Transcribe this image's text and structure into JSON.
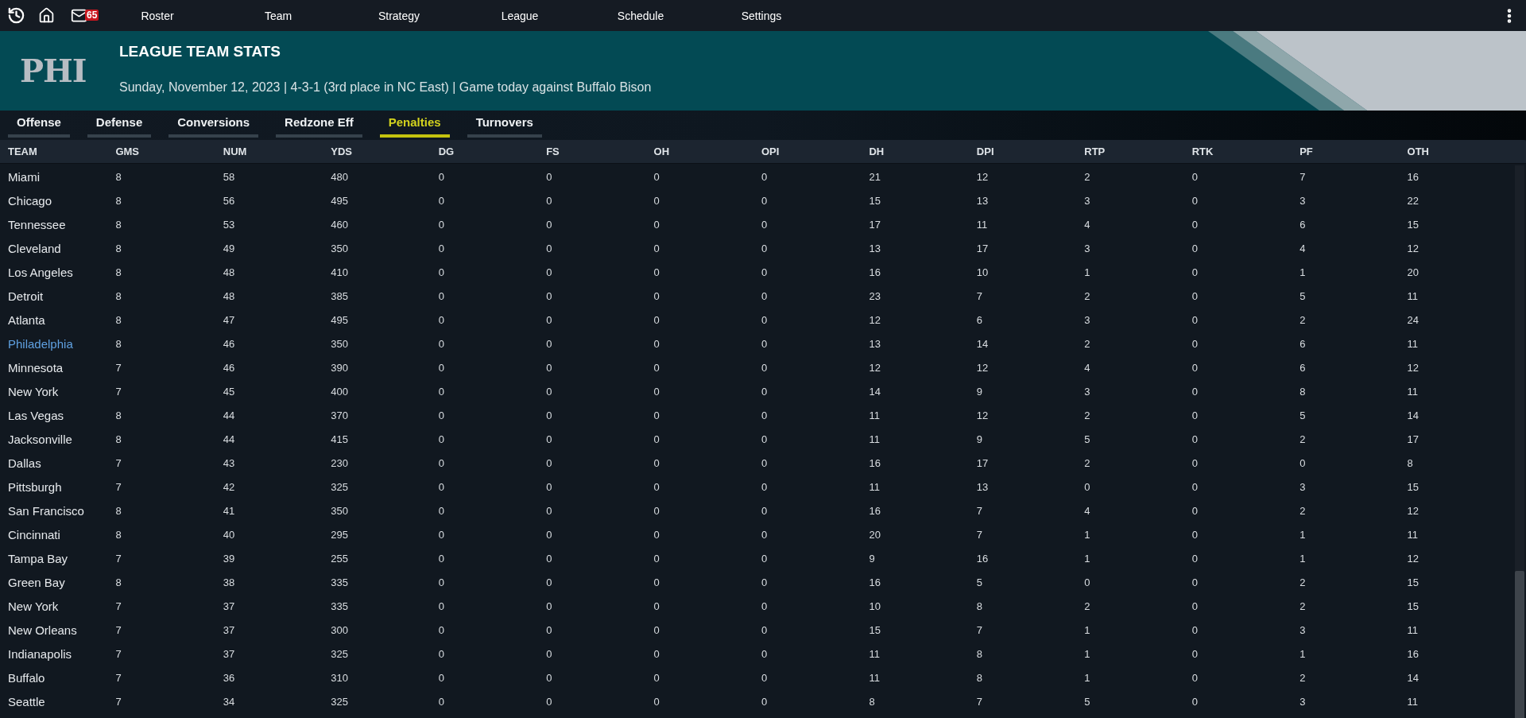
{
  "top_bar": {
    "mail_badge": "65",
    "nav": [
      {
        "label": "Roster"
      },
      {
        "label": "Team"
      },
      {
        "label": "Strategy"
      },
      {
        "label": "League"
      },
      {
        "label": "Schedule"
      },
      {
        "label": "Settings"
      }
    ]
  },
  "header": {
    "logo_text": "PHI",
    "title": "LEAGUE TEAM STATS",
    "subtitle": "Sunday, November 12, 2023 | 4-3-1 (3rd place in NC East) | Game today against Buffalo Bison"
  },
  "tabs": [
    {
      "label": "Offense",
      "selected": false
    },
    {
      "label": "Defense",
      "selected": false
    },
    {
      "label": "Conversions",
      "selected": false
    },
    {
      "label": "Redzone Eff",
      "selected": false
    },
    {
      "label": "Penalties",
      "selected": true
    },
    {
      "label": "Turnovers",
      "selected": false
    }
  ],
  "table": {
    "columns": [
      "TEAM",
      "GMS",
      "NUM",
      "YDS",
      "DG",
      "FS",
      "OH",
      "OPI",
      "DH",
      "DPI",
      "RTP",
      "RTK",
      "PF",
      "OTH"
    ],
    "rows": [
      {
        "team": "Miami",
        "values": [
          "8",
          "58",
          "480",
          "0",
          "0",
          "0",
          "0",
          "21",
          "12",
          "2",
          "0",
          "7",
          "16"
        ],
        "highlighted": false
      },
      {
        "team": "Chicago",
        "values": [
          "8",
          "56",
          "495",
          "0",
          "0",
          "0",
          "0",
          "15",
          "13",
          "3",
          "0",
          "3",
          "22"
        ],
        "highlighted": false
      },
      {
        "team": "Tennessee",
        "values": [
          "8",
          "53",
          "460",
          "0",
          "0",
          "0",
          "0",
          "17",
          "11",
          "4",
          "0",
          "6",
          "15"
        ],
        "highlighted": false
      },
      {
        "team": "Cleveland",
        "values": [
          "8",
          "49",
          "350",
          "0",
          "0",
          "0",
          "0",
          "13",
          "17",
          "3",
          "0",
          "4",
          "12"
        ],
        "highlighted": false
      },
      {
        "team": "Los Angeles",
        "values": [
          "8",
          "48",
          "410",
          "0",
          "0",
          "0",
          "0",
          "16",
          "10",
          "1",
          "0",
          "1",
          "20"
        ],
        "highlighted": false
      },
      {
        "team": "Detroit",
        "values": [
          "8",
          "48",
          "385",
          "0",
          "0",
          "0",
          "0",
          "23",
          "7",
          "2",
          "0",
          "5",
          "11"
        ],
        "highlighted": false
      },
      {
        "team": "Atlanta",
        "values": [
          "8",
          "47",
          "495",
          "0",
          "0",
          "0",
          "0",
          "12",
          "6",
          "3",
          "0",
          "2",
          "24"
        ],
        "highlighted": false
      },
      {
        "team": "Philadelphia",
        "values": [
          "8",
          "46",
          "350",
          "0",
          "0",
          "0",
          "0",
          "13",
          "14",
          "2",
          "0",
          "6",
          "11"
        ],
        "highlighted": true
      },
      {
        "team": "Minnesota",
        "values": [
          "7",
          "46",
          "390",
          "0",
          "0",
          "0",
          "0",
          "12",
          "12",
          "4",
          "0",
          "6",
          "12"
        ],
        "highlighted": false
      },
      {
        "team": "New York",
        "values": [
          "7",
          "45",
          "400",
          "0",
          "0",
          "0",
          "0",
          "14",
          "9",
          "3",
          "0",
          "8",
          "11"
        ],
        "highlighted": false
      },
      {
        "team": "Las Vegas",
        "values": [
          "8",
          "44",
          "370",
          "0",
          "0",
          "0",
          "0",
          "11",
          "12",
          "2",
          "0",
          "5",
          "14"
        ],
        "highlighted": false
      },
      {
        "team": "Jacksonville",
        "values": [
          "8",
          "44",
          "415",
          "0",
          "0",
          "0",
          "0",
          "11",
          "9",
          "5",
          "0",
          "2",
          "17"
        ],
        "highlighted": false
      },
      {
        "team": "Dallas",
        "values": [
          "7",
          "43",
          "230",
          "0",
          "0",
          "0",
          "0",
          "16",
          "17",
          "2",
          "0",
          "0",
          "8"
        ],
        "highlighted": false
      },
      {
        "team": "Pittsburgh",
        "values": [
          "7",
          "42",
          "325",
          "0",
          "0",
          "0",
          "0",
          "11",
          "13",
          "0",
          "0",
          "3",
          "15"
        ],
        "highlighted": false
      },
      {
        "team": "San Francisco",
        "values": [
          "8",
          "41",
          "350",
          "0",
          "0",
          "0",
          "0",
          "16",
          "7",
          "4",
          "0",
          "2",
          "12"
        ],
        "highlighted": false
      },
      {
        "team": "Cincinnati",
        "values": [
          "8",
          "40",
          "295",
          "0",
          "0",
          "0",
          "0",
          "20",
          "7",
          "1",
          "0",
          "1",
          "11"
        ],
        "highlighted": false
      },
      {
        "team": "Tampa Bay",
        "values": [
          "7",
          "39",
          "255",
          "0",
          "0",
          "0",
          "0",
          "9",
          "16",
          "1",
          "0",
          "1",
          "12"
        ],
        "highlighted": false
      },
      {
        "team": "Green Bay",
        "values": [
          "8",
          "38",
          "335",
          "0",
          "0",
          "0",
          "0",
          "16",
          "5",
          "0",
          "0",
          "2",
          "15"
        ],
        "highlighted": false
      },
      {
        "team": "New York",
        "values": [
          "7",
          "37",
          "335",
          "0",
          "0",
          "0",
          "0",
          "10",
          "8",
          "2",
          "0",
          "2",
          "15"
        ],
        "highlighted": false
      },
      {
        "team": "New Orleans",
        "values": [
          "7",
          "37",
          "300",
          "0",
          "0",
          "0",
          "0",
          "15",
          "7",
          "1",
          "0",
          "3",
          "11"
        ],
        "highlighted": false
      },
      {
        "team": "Indianapolis",
        "values": [
          "7",
          "37",
          "325",
          "0",
          "0",
          "0",
          "0",
          "11",
          "8",
          "1",
          "0",
          "1",
          "16"
        ],
        "highlighted": false
      },
      {
        "team": "Buffalo",
        "values": [
          "7",
          "36",
          "310",
          "0",
          "0",
          "0",
          "0",
          "11",
          "8",
          "1",
          "0",
          "2",
          "14"
        ],
        "highlighted": false
      },
      {
        "team": "Seattle",
        "values": [
          "7",
          "34",
          "325",
          "0",
          "0",
          "0",
          "0",
          "8",
          "7",
          "5",
          "0",
          "3",
          "11"
        ],
        "highlighted": false
      }
    ]
  }
}
